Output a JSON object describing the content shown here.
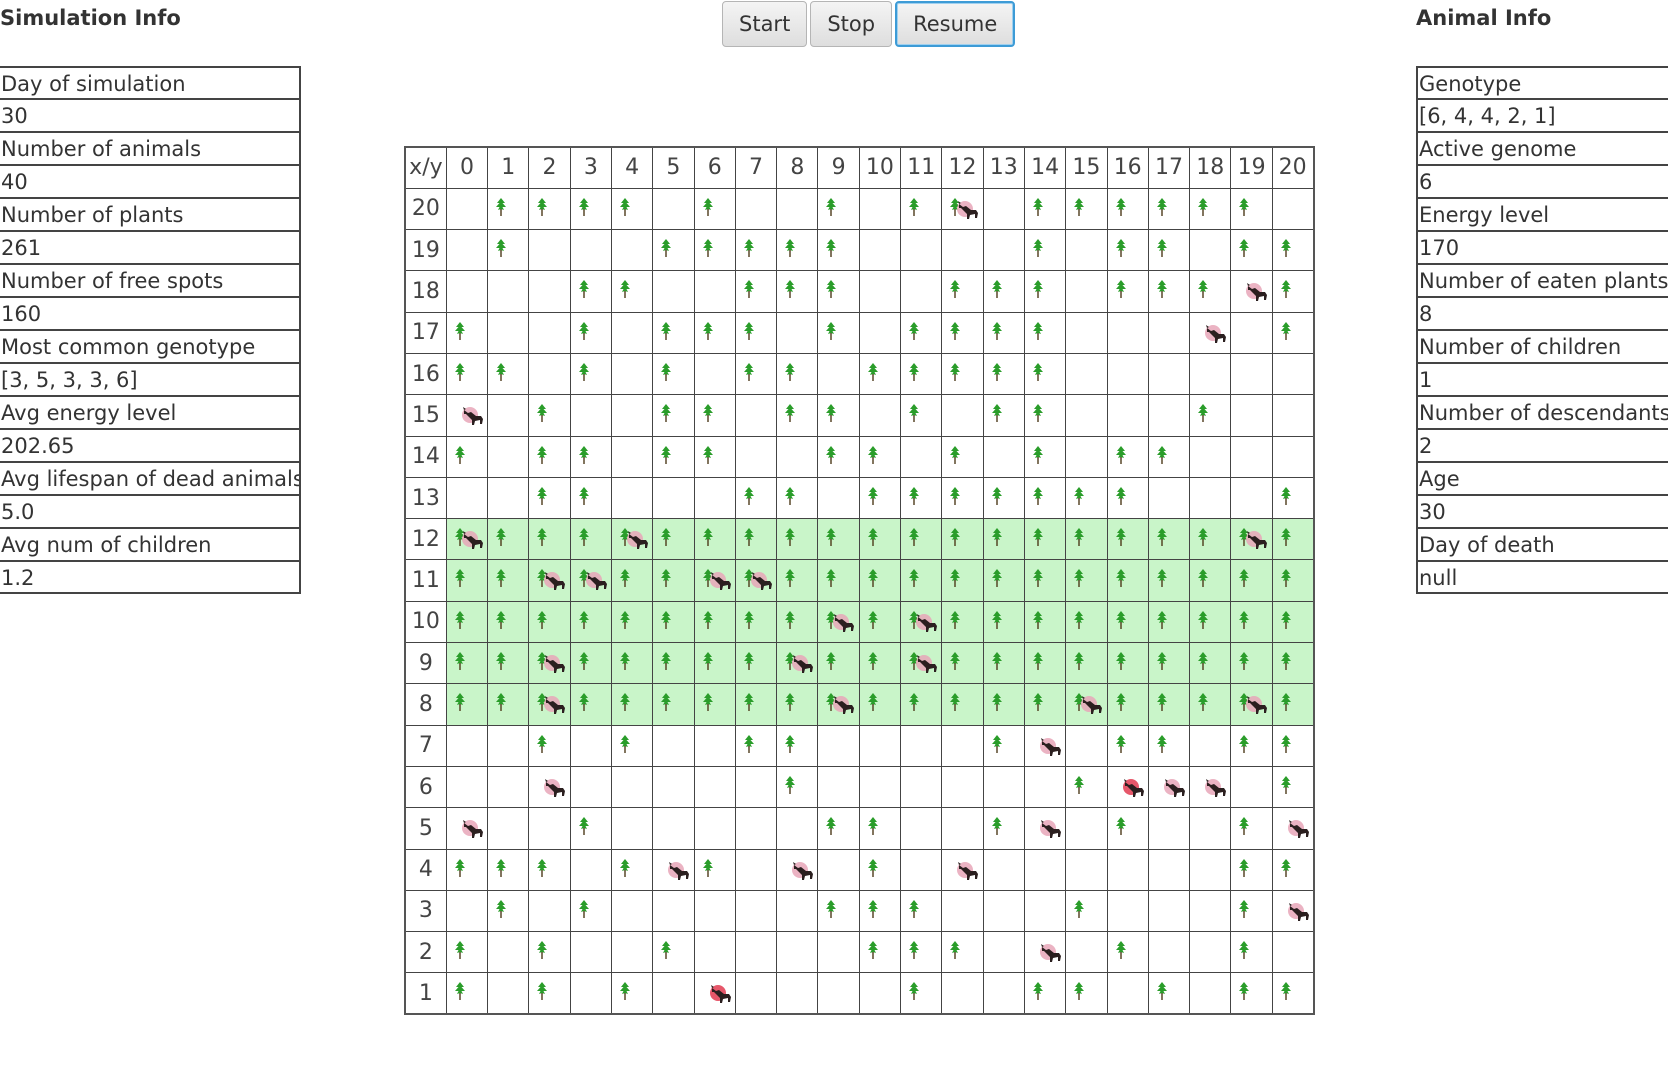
{
  "simulation_info": {
    "title": "Simulation Info",
    "rows": [
      {
        "label": "Day of simulation",
        "value": "30"
      },
      {
        "label": "Number of animals",
        "value": "40"
      },
      {
        "label": "Number of plants",
        "value": "261"
      },
      {
        "label": "Number of free spots",
        "value": "160"
      },
      {
        "label": "Most common genotype",
        "value": "[3, 5, 3, 3, 6]"
      },
      {
        "label": "Avg energy level",
        "value": "202.65"
      },
      {
        "label": "Avg lifespan of dead animals",
        "value": "5.0"
      },
      {
        "label": "Avg num of children",
        "value": "1.2"
      }
    ]
  },
  "animal_info": {
    "title": "Animal Info",
    "rows": [
      {
        "label": "Genotype",
        "value": "[6, 4, 4, 2, 1]"
      },
      {
        "label": "Active genome",
        "value": "6"
      },
      {
        "label": "Energy level",
        "value": "170"
      },
      {
        "label": "Number of eaten plants",
        "value": "8"
      },
      {
        "label": "Number of children",
        "value": "1"
      },
      {
        "label": "Number of descendants",
        "value": "2"
      },
      {
        "label": "Age",
        "value": "30"
      },
      {
        "label": "Day of death",
        "value": "null"
      }
    ]
  },
  "controls": {
    "start_label": "Start",
    "stop_label": "Stop",
    "resume_label": "Resume",
    "focused": "resume"
  },
  "map": {
    "corner_label": "x/y",
    "x_labels": [
      "0",
      "1",
      "2",
      "3",
      "4",
      "5",
      "6",
      "7",
      "8",
      "9",
      "10",
      "11",
      "12",
      "13",
      "14",
      "15",
      "16",
      "17",
      "18",
      "19",
      "20"
    ],
    "y_labels": [
      "20",
      "19",
      "18",
      "17",
      "16",
      "15",
      "14",
      "13",
      "12",
      "11",
      "10",
      "9",
      "8",
      "7",
      "6",
      "5",
      "4",
      "3",
      "2",
      "1"
    ],
    "jungle_rows": [
      "12",
      "11",
      "10",
      "9",
      "8"
    ],
    "colors": {
      "jungle": "#c9f5c9",
      "plant": "#2a9d2a",
      "animal": "#2b1f1f",
      "animal_blob": "#e8a6b8",
      "animal_blob_low": "#e23a50"
    },
    "rows": [
      "LPPPP.P..P.PS.PPPPPP.P",
      ".P...PPPPP....P.PP.PP",
      "...PP..PPP..PPP.PPPAP",
      "P..P.PPP.P.PPPP...A.P.",
      "PP.P.P.PP.PPPPP......",
      "A.P..PP.PP.P.PP...P..",
      "P.PP.PP..PP.P.P.PP...",
      "..PP...PP.PPPPPPP...P",
      "BPPPBPPPPPPPPPPPPPPBP",
      "PPBBPPBBPPPPPPPPPPPPP",
      "PPPPPPPPPBPBPPPPPPPPP",
      "PPBPPPPPBPPBPPPPPPPPP",
      "PPBPPPPPPBPPPPPBPPPBP",
      "..P.P..PP....PA.PP.PP",
      "..A.....P......PRAA.P",
      "A..P.....PP..PA.P..PAP",
      "PPP.PAP.A.P.A......PP",
      ".P.P.....PPP...P...PAP",
      "P.P..P....PPP.A.P..P.",
      "P.P.P.R....P..PP.P.PPP"
    ]
  }
}
